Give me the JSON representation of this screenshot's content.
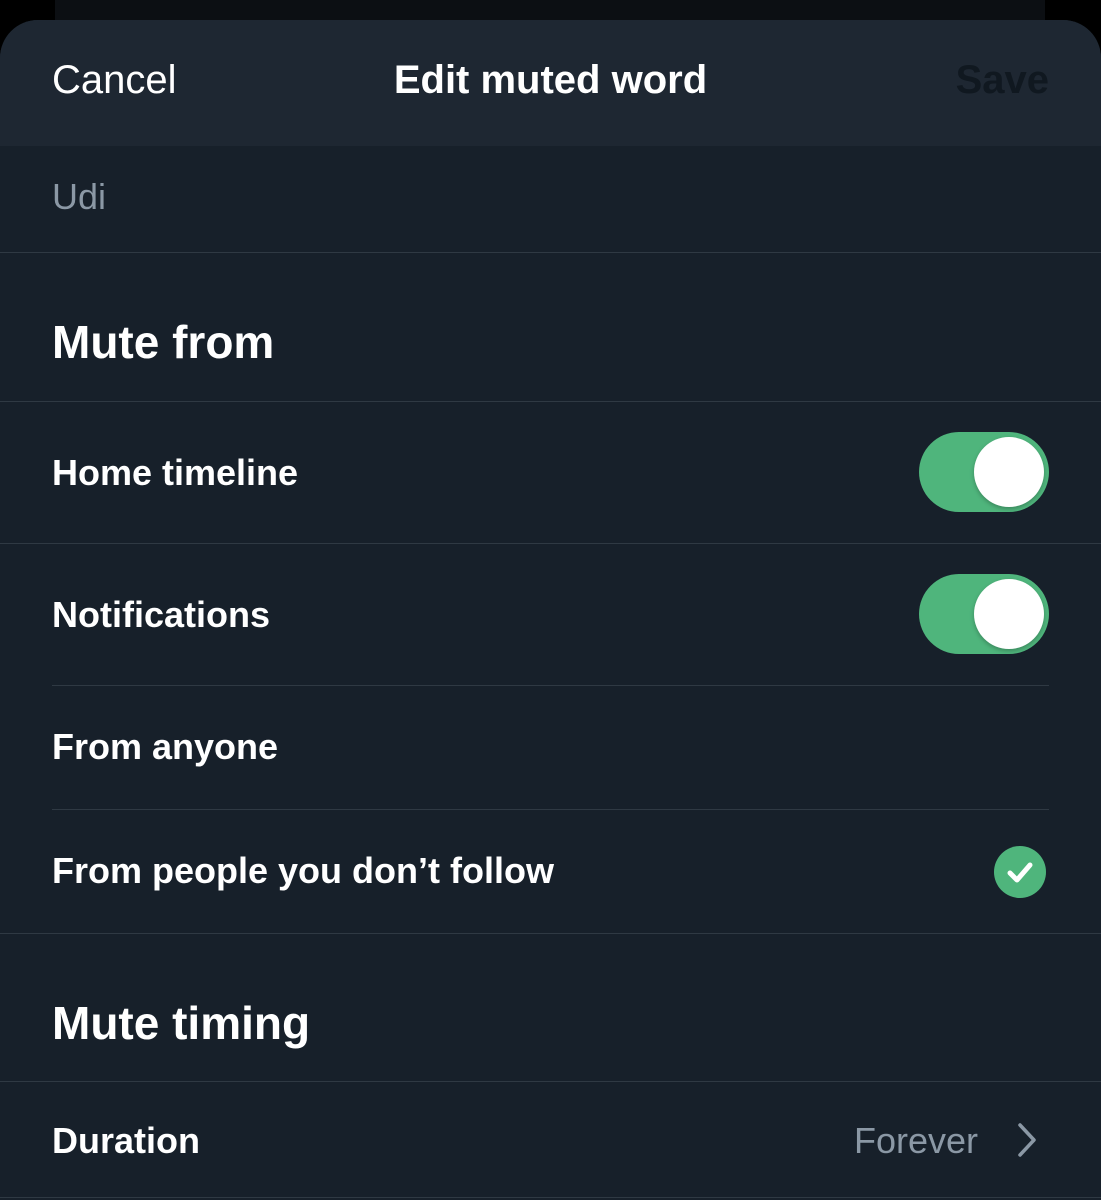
{
  "colors": {
    "accent_green": "#4fb57c",
    "sheet_background": "#17202a",
    "navbar_background": "#1e2732",
    "secondary_text": "#8b98a5",
    "divider": "#2f3943"
  },
  "navbar": {
    "cancel_label": "Cancel",
    "title": "Edit muted word",
    "save_label": "Save"
  },
  "word_field": {
    "value": "Udi"
  },
  "mute_from": {
    "title": "Mute from",
    "home_timeline": {
      "label": "Home timeline",
      "enabled": true
    },
    "notifications": {
      "label": "Notifications",
      "enabled": true
    },
    "from_anyone": {
      "label": "From anyone",
      "selected": false
    },
    "from_people_not_followed": {
      "label": "From people you don’t follow",
      "selected": true
    }
  },
  "mute_timing": {
    "title": "Mute timing",
    "duration_label": "Duration",
    "duration_value": "Forever"
  },
  "icons": {
    "selected_check": "checkmark-circle-icon",
    "disclosure": "chevron-right-icon"
  }
}
